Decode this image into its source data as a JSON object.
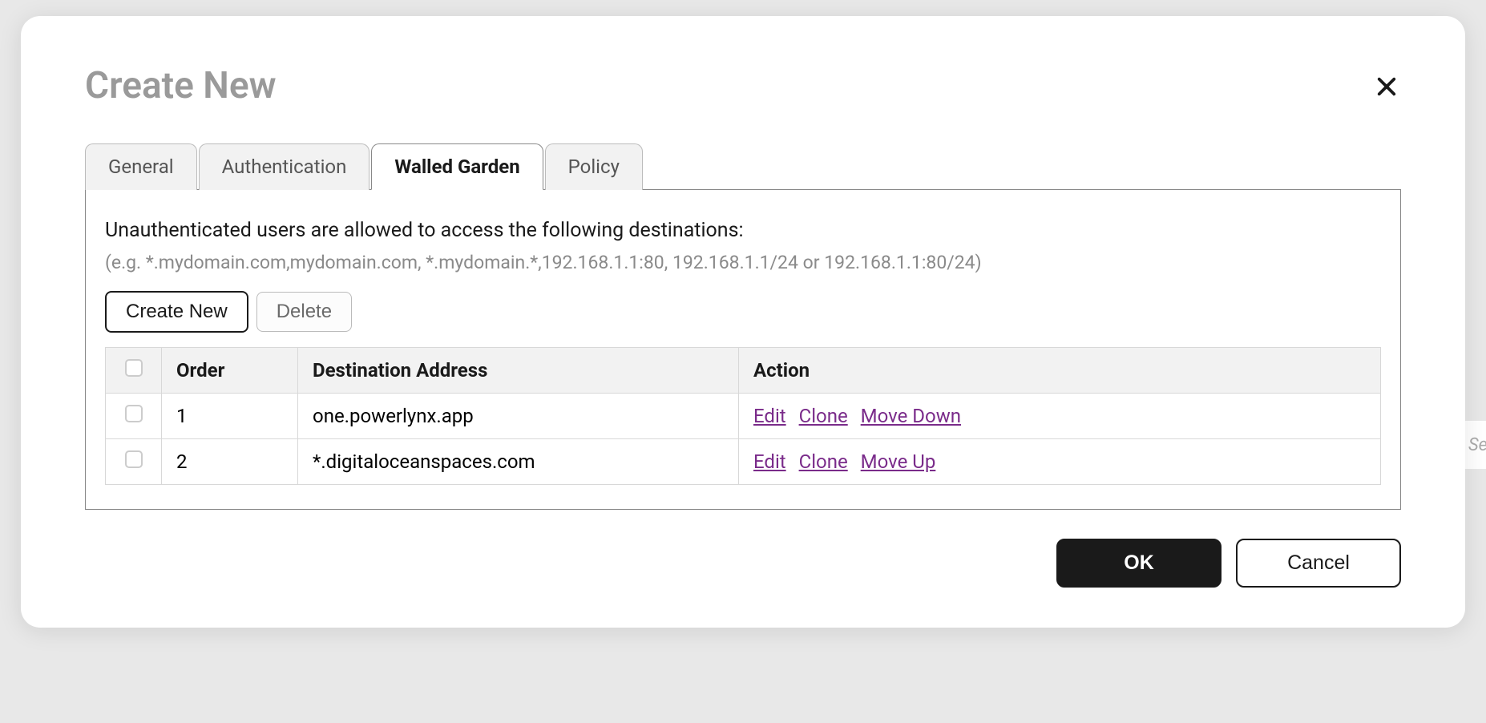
{
  "modal": {
    "title": "Create New",
    "tabs": {
      "general": "General",
      "authentication": "Authentication",
      "walled_garden": "Walled Garden",
      "policy": "Policy"
    },
    "content": {
      "description": "Unauthenticated users are allowed to access the following destinations:",
      "hint": "(e.g. *.mydomain.com,mydomain.com, *.mydomain.*,192.168.1.1:80, 192.168.1.1/24 or 192.168.1.1:80/24)",
      "create_new_btn": "Create New",
      "delete_btn": "Delete",
      "table": {
        "headers": {
          "order": "Order",
          "destination": "Destination Address",
          "action": "Action"
        },
        "rows": [
          {
            "order": "1",
            "destination": "one.powerlynx.app",
            "actions": {
              "edit": "Edit",
              "clone": "Clone",
              "move": "Move Down"
            }
          },
          {
            "order": "2",
            "destination": "*.digitaloceanspaces.com",
            "actions": {
              "edit": "Edit",
              "clone": "Clone",
              "move": "Move Up"
            }
          }
        ]
      }
    },
    "footer": {
      "ok": "OK",
      "cancel": "Cancel"
    }
  },
  "backdrop": {
    "search_placeholder_fragment": "Se"
  }
}
